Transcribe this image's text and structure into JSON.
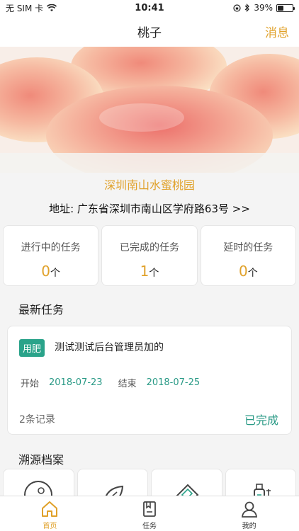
{
  "status_bar": {
    "carrier": "无 SIM 卡",
    "time": "10:41",
    "battery": "39%",
    "battery_level": 0.39
  },
  "nav": {
    "title": "桃子",
    "action": "消息"
  },
  "farm": {
    "name": "深圳南山水蜜桃园",
    "address": "地址: 广东省深圳市南山区学府路63号 >>"
  },
  "stats": [
    {
      "label": "进行中的任务",
      "value": "0",
      "unit": "个"
    },
    {
      "label": "已完成的任务",
      "value": "1",
      "unit": "个"
    },
    {
      "label": "延时的任务",
      "value": "0",
      "unit": "个"
    }
  ],
  "latest": {
    "section_title": "最新任务",
    "task": {
      "tag": "用肥",
      "title": "测试测试后台管理员加的",
      "start_label": "开始",
      "start_date": "2018-07-23",
      "end_label": "结束",
      "end_date": "2018-07-25",
      "records": "2条记录",
      "status": "已完成"
    }
  },
  "archive": {
    "section_title": "溯源档案",
    "icons": [
      "sun-plant-icon",
      "leaf-icon",
      "certificate-icon",
      "spray-bottle-icon"
    ]
  },
  "tabs": [
    {
      "label": "首页",
      "icon": "home-icon"
    },
    {
      "label": "任务",
      "icon": "task-icon"
    },
    {
      "label": "我的",
      "icon": "profile-icon"
    }
  ],
  "colors": {
    "accent": "#e0a12a",
    "green": "#2aa38a"
  }
}
